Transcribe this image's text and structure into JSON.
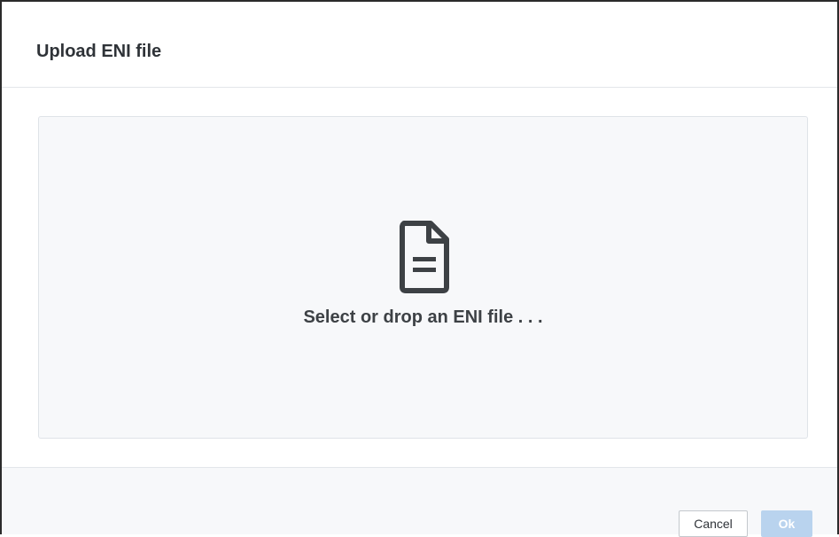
{
  "dialog": {
    "title": "Upload ENI file"
  },
  "dropzone": {
    "prompt": "Select or drop an ENI file . . .",
    "icon": "file-text-icon"
  },
  "footer": {
    "cancel_label": "Cancel",
    "ok_label": "Ok",
    "ok_disabled": true
  },
  "colors": {
    "primary_disabled": "#b9d3ee",
    "dropzone_background": "#f7f8fa",
    "title_text": "#2f3338"
  }
}
